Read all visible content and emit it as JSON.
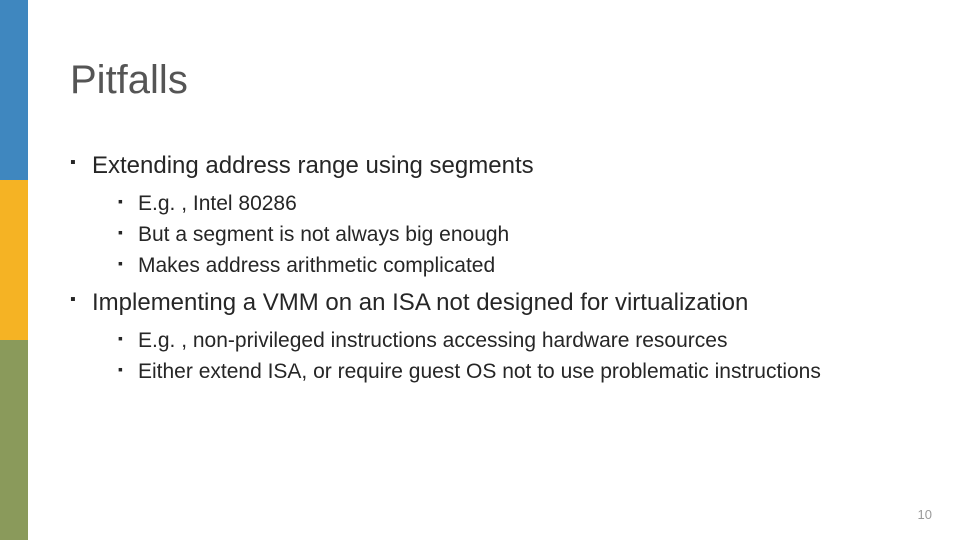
{
  "title": "Pitfalls",
  "bullets": [
    {
      "text": "Extending address range using segments",
      "sub": [
        "E.g. , Intel 80286",
        "But a segment is not always big enough",
        "Makes address arithmetic complicated"
      ]
    },
    {
      "text": "Implementing a VMM on an ISA not designed for virtualization",
      "sub": [
        "E.g. , non-privileged instructions accessing hardware resources",
        "Either extend ISA, or require guest OS not to use problematic instructions"
      ]
    }
  ],
  "page_number": "10"
}
